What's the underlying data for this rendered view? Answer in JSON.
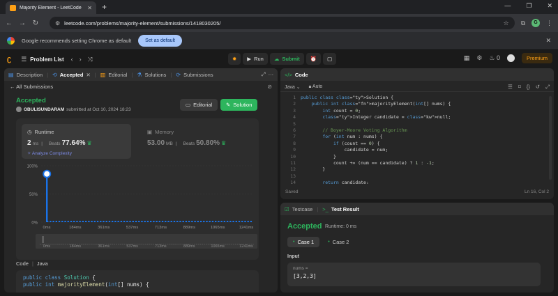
{
  "browser": {
    "tab_title": "Majority Element - LeetCode",
    "url": "leetcode.com/problems/majority-element/submissions/1418030205/",
    "profile_initial": "G"
  },
  "infobar": {
    "message": "Google recommends setting Chrome as default",
    "button": "Set as default"
  },
  "nav": {
    "problem_list": "Problem List",
    "run": "Run",
    "submit": "Submit",
    "streak": "0",
    "premium": "Premium"
  },
  "left_tabs": [
    {
      "label": "Description"
    },
    {
      "label": "Accepted"
    },
    {
      "label": "Editorial"
    },
    {
      "label": "Solutions"
    },
    {
      "label": "Submissions"
    }
  ],
  "submission": {
    "back": "All Submissions",
    "status": "Accepted",
    "user": "OBULISUNDARAM",
    "submitted": "submitted at Oct 10, 2024 18:23",
    "editorial_btn": "Editorial",
    "solution_btn": "Solution"
  },
  "runtime": {
    "label": "Runtime",
    "value": "2",
    "unit": "ms",
    "beats_label": "Beats",
    "beats": "77.64%",
    "analyze": "Analyze Complexity"
  },
  "memory": {
    "label": "Memory",
    "value": "53.00",
    "unit": "MB",
    "beats_label": "Beats",
    "beats": "50.80%"
  },
  "chart_data": {
    "type": "bar",
    "ytick_labels": [
      "100%",
      "50%",
      "0%"
    ],
    "xtick_labels": [
      "0ms",
      "184ms",
      "361ms",
      "537ms",
      "713ms",
      "889ms",
      "1065ms",
      "1241ms"
    ],
    "ylim": [
      0,
      100
    ],
    "highlight": {
      "x": "0ms",
      "value": 88
    },
    "baseline_bins": 70,
    "grid": true,
    "accent": "#1a73e8"
  },
  "code_section": {
    "label": "Code",
    "lang": "Java",
    "snippet": [
      "public class Solution {",
      "    public int majorityElement(int[] nums) {"
    ]
  },
  "editor": {
    "title": "Code",
    "lang": "Java",
    "mode": "Auto",
    "lines": [
      "public class Solution {",
      "    public int majorityElement(int[] nums) {",
      "        int count = 0;",
      "        Integer candidate = null;",
      "",
      "        // Boyer-Moore Voting Algorithm",
      "        for (int num : nums) {",
      "            if (count == 0) {",
      "                candidate = num;",
      "            }",
      "            count += (num == candidate) ? 1 : -1;",
      "        }",
      "",
      "        return candidate;"
    ],
    "status": "Saved",
    "cursor": "Ln 16, Col 2"
  },
  "result": {
    "tabs": [
      "Testcase",
      "Test Result"
    ],
    "status": "Accepted",
    "runtime": "Runtime: 0 ms",
    "cases": [
      "Case 1",
      "Case 2"
    ],
    "input_label": "Input",
    "param_name": "nums =",
    "param_value": "[3,2,3]"
  },
  "colors": {
    "accent_green": "#2db55d",
    "brand_orange": "#ffa116"
  }
}
